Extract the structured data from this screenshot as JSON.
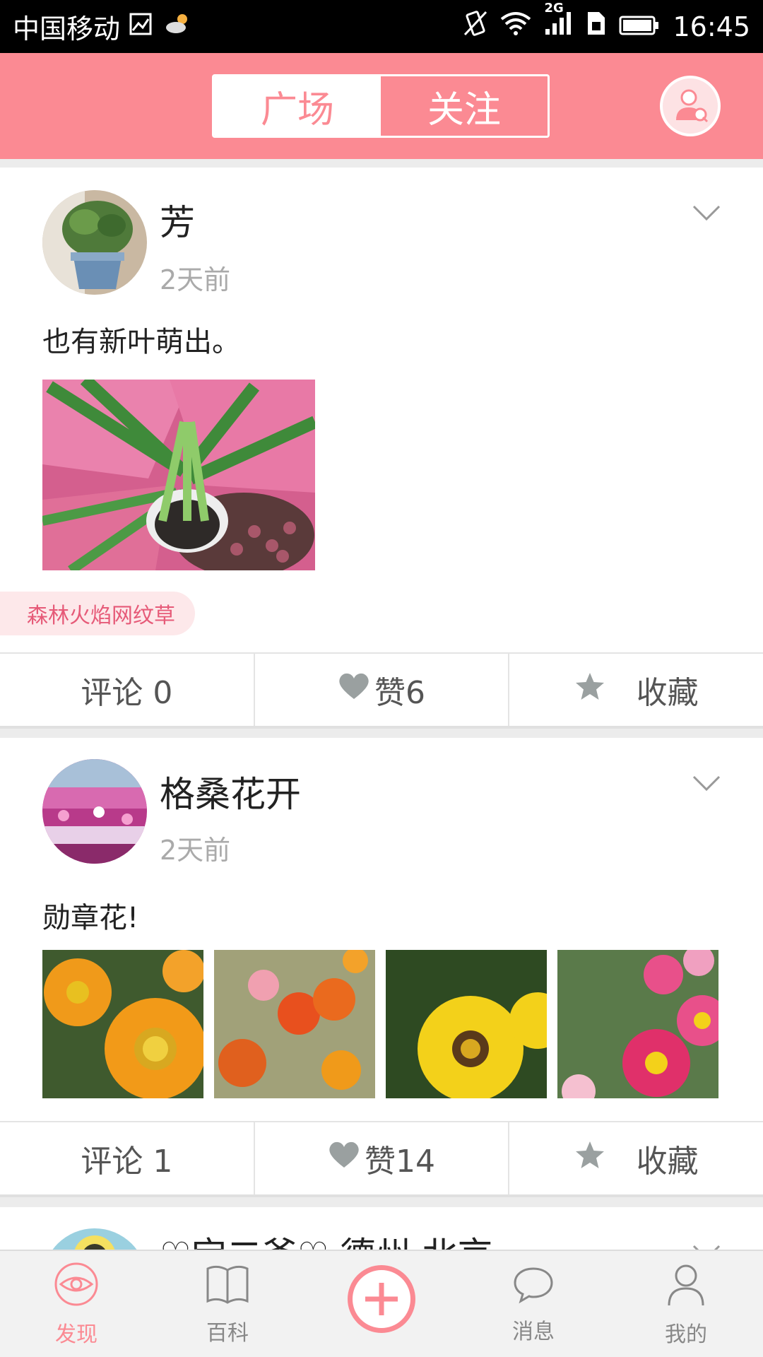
{
  "status_bar": {
    "carrier": "中国移动",
    "network": "2G",
    "time": "16:45"
  },
  "header": {
    "tabs": [
      {
        "label": "广场",
        "active": true
      },
      {
        "label": "关注",
        "active": false
      }
    ],
    "user_search_icon": "user-search-icon"
  },
  "posts": [
    {
      "username": "芳",
      "time": "2天前",
      "text": "也有新叶萌出。",
      "tag": "森林火焰网纹草",
      "comment_label": "评论 0",
      "like_label": "赞6",
      "favorite_label": "收藏"
    },
    {
      "username": "格桑花开",
      "time": "2天前",
      "text": "勋章花!",
      "comment_label": "评论 1",
      "like_label": "赞14",
      "favorite_label": "收藏"
    },
    {
      "username": "♡宝二爷♡ 德州 北京"
    }
  ],
  "bottom_nav": {
    "items": [
      {
        "label": "发现",
        "icon": "eye-icon",
        "active": true
      },
      {
        "label": "百科",
        "icon": "book-icon",
        "active": false
      },
      {
        "label": "",
        "icon": "plus-icon",
        "active": false
      },
      {
        "label": "消息",
        "icon": "chat-bubble-icon",
        "active": false
      },
      {
        "label": "我的",
        "icon": "person-icon",
        "active": false
      }
    ]
  },
  "colors": {
    "accent": "#fb8a93",
    "tag_bg": "#fde8ea",
    "tag_text": "#e65a78"
  }
}
